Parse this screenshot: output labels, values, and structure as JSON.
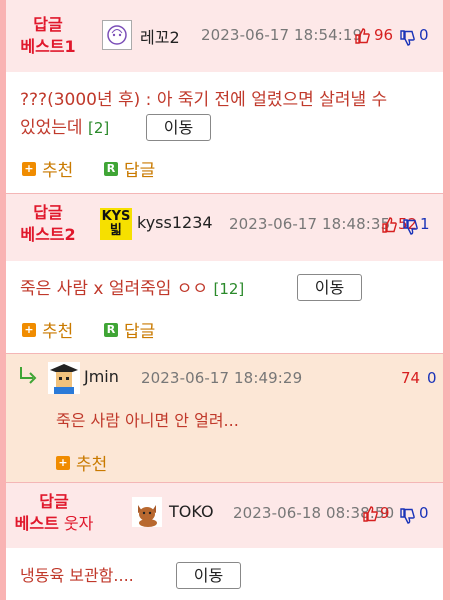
{
  "comments": [
    {
      "badge_line1": "답글",
      "badge_line2": "베스트1",
      "nick": "레꼬2",
      "date": "2023-06-17 18:54:19",
      "up": "96",
      "down": "0",
      "text_line1": "???(3000년 후) : 아 죽기 전에 얼렸으면 살려낼 수",
      "text_line2": "있었는데",
      "reply_count": "[2]",
      "move_label": "이동",
      "recommend_label": "추천",
      "reply_label": "답글"
    },
    {
      "badge_line1": "답글",
      "badge_line2": "베스트2",
      "nick": "kyss1234",
      "date": "2023-06-17 18:48:35",
      "up": "52",
      "down": "1",
      "text": "죽은 사람 x 얼려죽임 ㅇㅇ",
      "reply_count": "[12]",
      "move_label": "이동",
      "recommend_label": "추천",
      "reply_label": "답글"
    },
    {
      "badge_line1": "답글",
      "badge_line2_bold": "베스트",
      "badge_line2_normal": " 웃자",
      "nick": "TOKO",
      "date": "2023-06-18 08:38:50",
      "up": "9",
      "down": "0",
      "text": "냉동육 보관함....",
      "move_label": "이동"
    }
  ],
  "reply": {
    "nick": "Jmin",
    "date": "2023-06-17 18:49:29",
    "up": "74",
    "down": "0",
    "text": "죽은 사람 아니면 안 얼려...",
    "recommend_label": "추천"
  },
  "avatar_texts": {
    "kyss_top": "KYS",
    "kyss_bottom": "빏"
  },
  "icons": [
    "thumbs-up-icon",
    "thumbs-down-icon",
    "plus-square-icon",
    "r-square-icon",
    "reply-arrow-icon"
  ],
  "colors": {
    "best": "#e0182c",
    "up": "#d61f1f",
    "down": "#1a33b8",
    "recommend": "#c97a00",
    "reply_count": "#2b8a2b",
    "border": "#f9b3b3"
  }
}
